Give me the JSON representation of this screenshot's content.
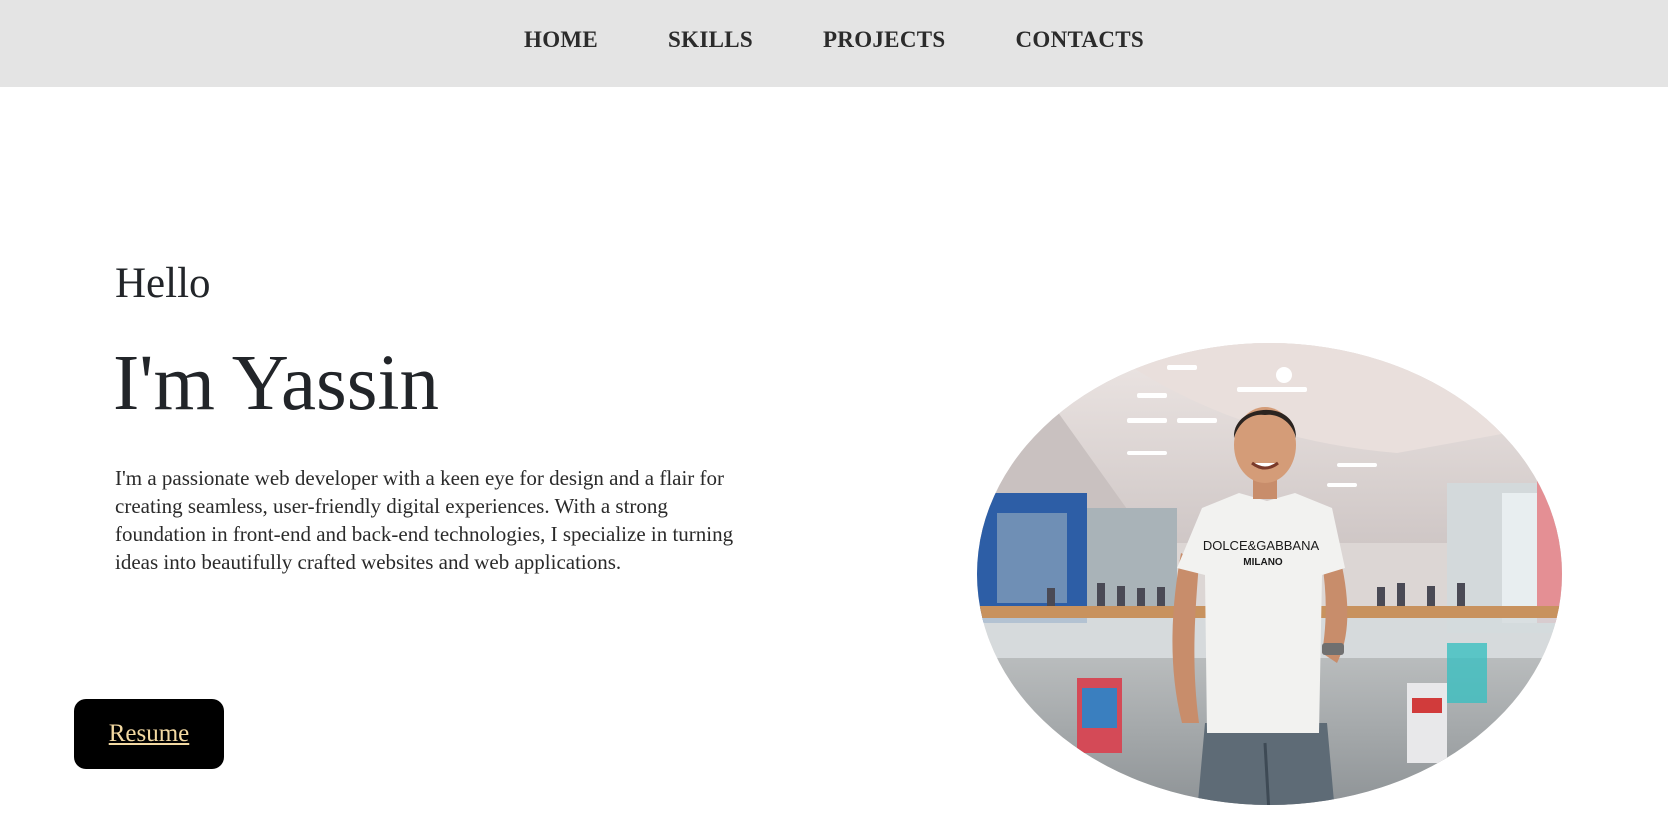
{
  "nav": {
    "items": [
      {
        "label": "HOME"
      },
      {
        "label": "SKILLS"
      },
      {
        "label": "PROJECTS"
      },
      {
        "label": "CONTACTS"
      }
    ]
  },
  "hero": {
    "greeting": "Hello",
    "name": "I'm Yassin",
    "bio": "I'm a passionate web developer with a keen eye for design and a flair for creating seamless, user-friendly digital experiences. With a strong foundation in front-end and back-end technologies, I specialize in turning ideas into beautifully crafted websites and web applications.",
    "resume_label": "Resume",
    "photo": {
      "icon": "profile-photo",
      "shirt_text_line1": "DOLCE&GABBANA",
      "shirt_text_line2": "MILANO"
    }
  },
  "colors": {
    "navbar_bg": "#e4e4e4",
    "button_bg": "#000000",
    "button_text": "#f3d9a2"
  }
}
